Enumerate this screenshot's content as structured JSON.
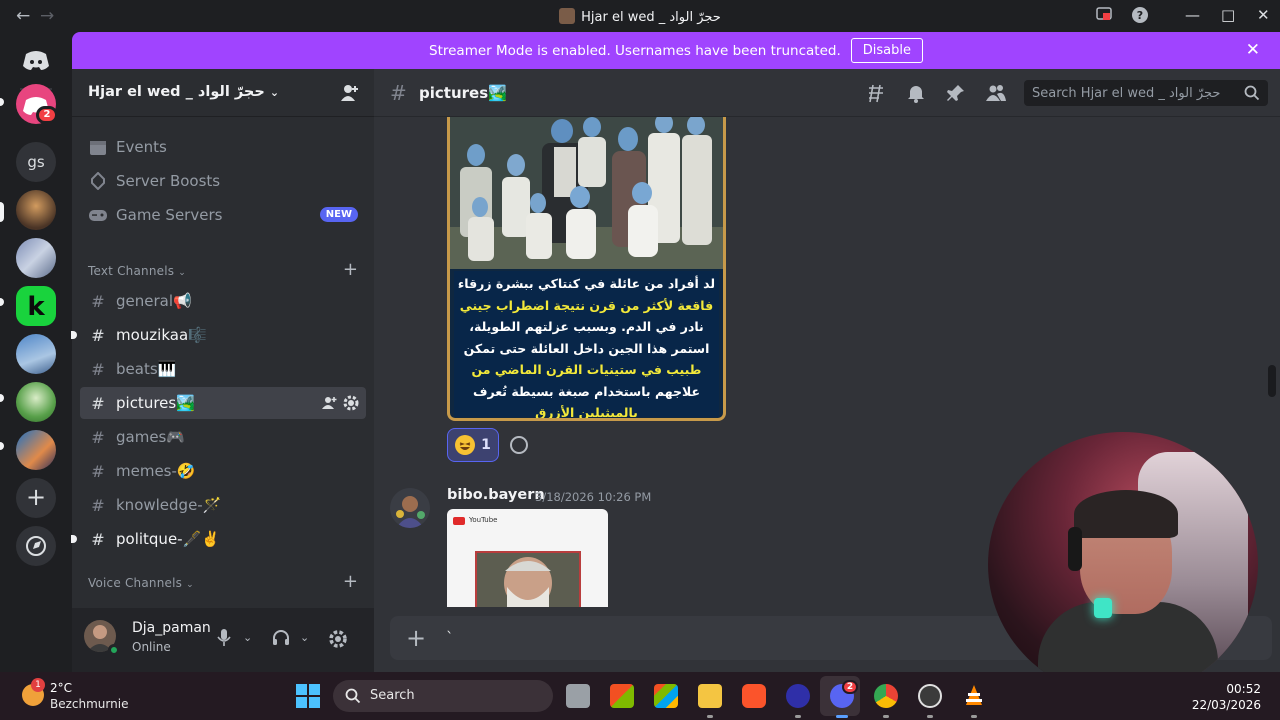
{
  "window": {
    "title": "Hjar el wed _ حجرّ الواد",
    "back_icon": "arrow-left-icon",
    "forward_icon": "arrow-right-icon"
  },
  "banner": {
    "text": "Streamer Mode is enabled. Usernames have been truncated.",
    "button": "Disable"
  },
  "rail": {
    "dm_badge": "2",
    "gs_label": "gs"
  },
  "guild": {
    "name": "Hjar el wed _ حجرّ الواد"
  },
  "sidebar": {
    "top_items": [
      {
        "label": "Events",
        "icon": "calendar-icon"
      },
      {
        "label": "Server Boosts",
        "icon": "boost-icon"
      },
      {
        "label": "Game Servers",
        "icon": "gamepad-icon",
        "badge": "NEW"
      }
    ],
    "text_category": "Text Channels",
    "channels": [
      {
        "label": "general📢"
      },
      {
        "label": "mouzikaa🎼"
      },
      {
        "label": "beats🎹"
      },
      {
        "label": "pictures🏞️"
      },
      {
        "label": "games🎮"
      },
      {
        "label": "memes-🤣"
      },
      {
        "label": "knowledge-🪄"
      },
      {
        "label": "politque-🖋️✌️"
      }
    ],
    "voice_category": "Voice Channels"
  },
  "user": {
    "name": "Dja_paman",
    "status": "Online"
  },
  "chat": {
    "channel_name": "pictures🏞️",
    "search_placeholder": "Search Hjar el wed _ حجرّ الواد",
    "post_lines": [
      "لد أفراد من عائلة في كنتاكي ببشرة زرقاء",
      "فاقعة لأكثر من قرن نتيجة اضطراب جيني",
      "نادر في الدم. وبسبب عزلتهم الطويلة،",
      "استمر هذا الجين داخل العائلة حتى تمكن",
      "طبيب في ستينيات القرن الماضي من",
      "علاجهم باستخدام صبغة بسيطة تُعرف",
      "بالميثيلين الأزرق"
    ],
    "reaction_count": "1",
    "message": {
      "author": "bibo.bayern",
      "timestamp": "3/18/2026 10:26 PM"
    },
    "thumb_app": "YouTube",
    "composer_value": "`"
  },
  "taskbar": {
    "weather_badge": "1",
    "temperature": "2°C",
    "location": "Bezchmurnie",
    "search_label": "Search",
    "discord_badge": "2",
    "time": "00:52",
    "date": "22/03/2026"
  },
  "colors": {
    "accent": "#a044ff",
    "blurple": "#5865f2",
    "online": "#23a55a",
    "notification": "#f23f43"
  }
}
